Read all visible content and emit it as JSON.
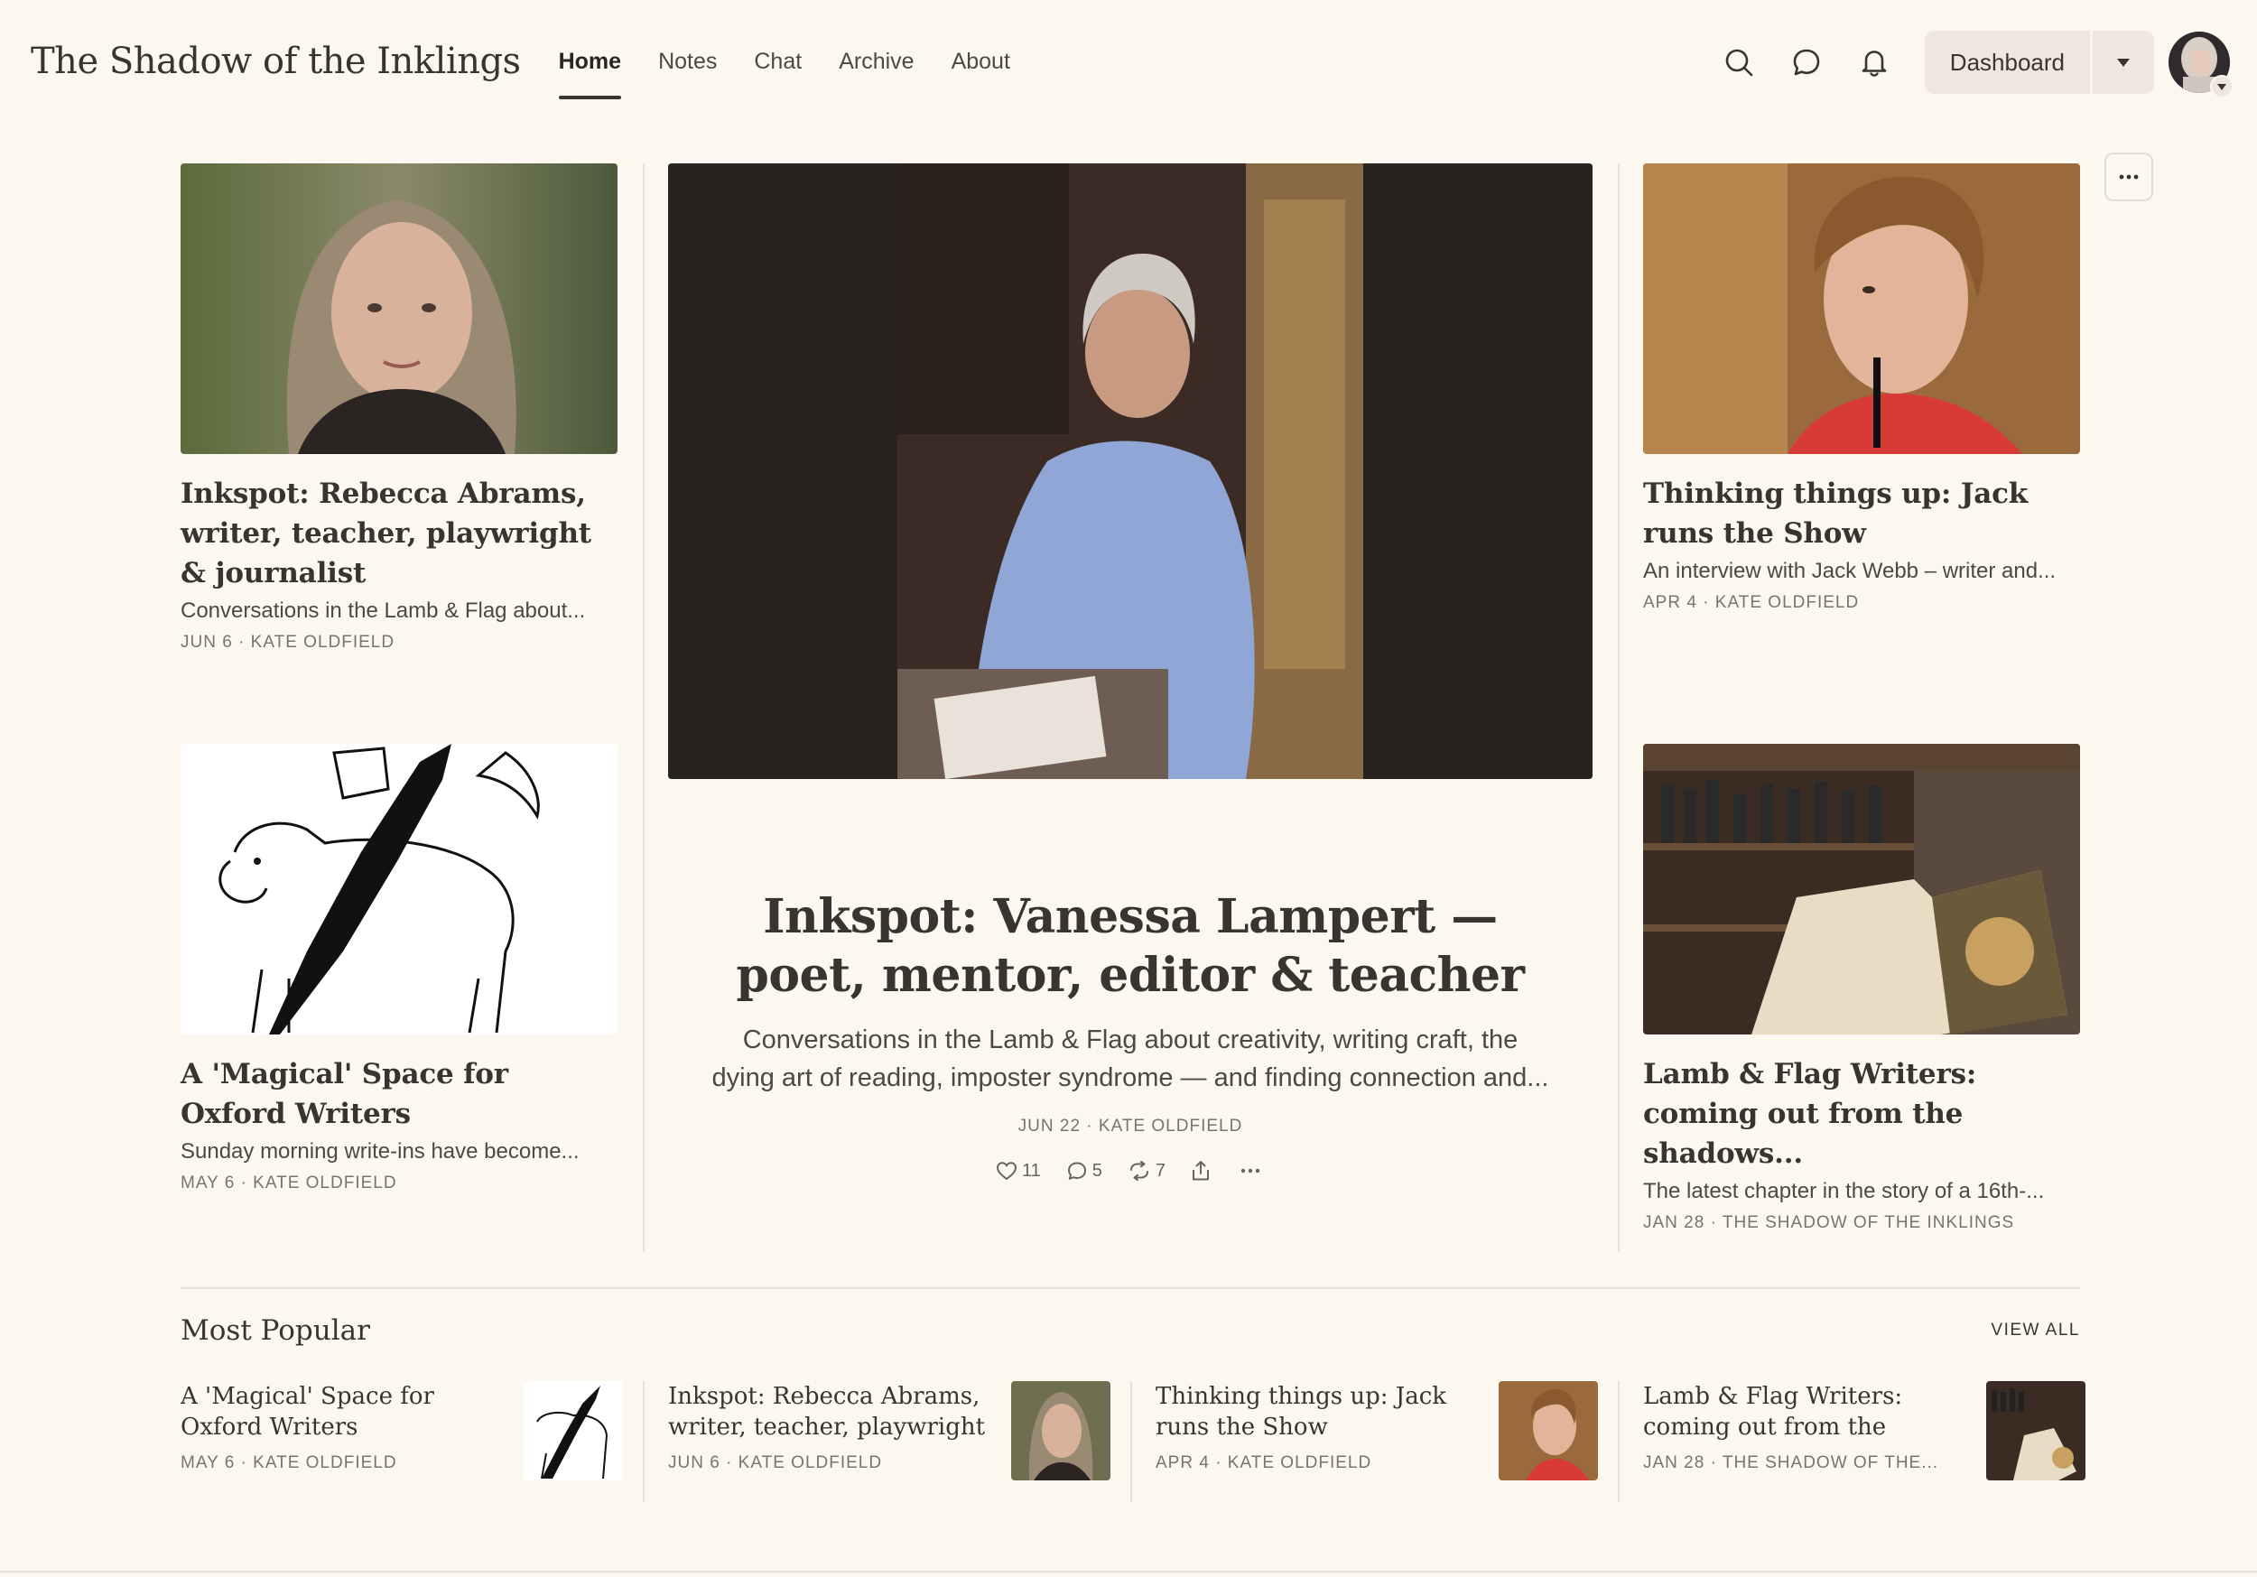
{
  "header": {
    "publication_title": "The Shadow of the Inklings",
    "nav": [
      {
        "label": "Home",
        "active": true
      },
      {
        "label": "Notes",
        "active": false
      },
      {
        "label": "Chat",
        "active": false
      },
      {
        "label": "Archive",
        "active": false
      },
      {
        "label": "About",
        "active": false
      }
    ],
    "icons": [
      "search-icon",
      "chat-bubble-icon",
      "bell-icon"
    ],
    "dashboard_label": "Dashboard"
  },
  "posts": {
    "top_left": {
      "title": "Inkspot: Rebecca Abrams, writer, teacher, playwright & journalist",
      "subtitle": "Conversations in the Lamb & Flag about...",
      "meta": "JUN 6 · KATE OLDFIELD"
    },
    "bottom_left": {
      "title": "A 'Magical' Space for Oxford Writers",
      "subtitle": "Sunday morning write-ins have become...",
      "meta": "MAY 6 · KATE OLDFIELD"
    },
    "top_right": {
      "title": "Thinking things up: Jack runs the Show",
      "subtitle": "An interview with Jack Webb – writer and...",
      "meta": "APR 4 · KATE OLDFIELD"
    },
    "bottom_right": {
      "title": "Lamb & Flag Writers: coming out from the shadows...",
      "subtitle": "The latest chapter in the story of a 16th-...",
      "meta": "JAN 28 · THE SHADOW OF THE INKLINGS"
    }
  },
  "hero": {
    "title_line1": "Inkspot: Vanessa Lampert —",
    "title_line2": "poet, mentor, editor & teacher",
    "subtitle_line1": "Conversations in the Lamb & Flag about creativity, writing craft, the",
    "subtitle_line2": "dying art of reading, imposter syndrome — and finding connection and...",
    "meta": "JUN 22 · KATE OLDFIELD",
    "likes": "11",
    "comments": "5",
    "restacks": "7"
  },
  "popular": {
    "heading": "Most Popular",
    "view_all": "VIEW ALL",
    "items": [
      {
        "title": "A 'Magical' Space for Oxford Writers",
        "meta": "MAY 6 · KATE OLDFIELD"
      },
      {
        "title": "Inkspot: Rebecca Abrams, writer, teacher, playwright ...",
        "meta": "JUN 6 · KATE OLDFIELD"
      },
      {
        "title": "Thinking things up: Jack runs the Show",
        "meta": "APR 4 · KATE OLDFIELD"
      },
      {
        "title": "Lamb & Flag Writers: coming out from the shadows...",
        "meta": "JAN 28 · THE SHADOW OF THE..."
      }
    ]
  },
  "colors": {
    "background": "#fdf8ef",
    "text": "#3a3330",
    "muted": "#7a726c",
    "button_bg": "#efe7dd"
  }
}
